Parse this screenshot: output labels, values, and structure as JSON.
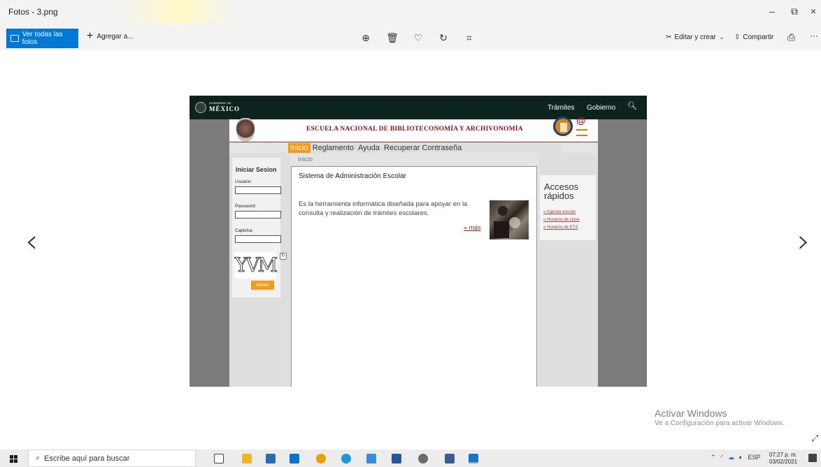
{
  "window": {
    "title": "Fotos - 3.png",
    "min": "–",
    "max": "⧉",
    "close": "×"
  },
  "toolbar": {
    "all_photos": "Ver todas las fotos",
    "add": "Agregar a...",
    "edit_create": "Editar y crear",
    "share": "Compartir",
    "icons": [
      "zoom-in-icon",
      "delete-icon",
      "heart-icon",
      "rotate-icon",
      "crop-icon",
      "print-icon",
      "more-icon"
    ]
  },
  "photo": {
    "gov": {
      "small": "GOBIERNO DE",
      "mexico": "MÉXICO",
      "tramites": "Trámites",
      "gobierno": "Gobierno"
    },
    "school": "ESCUELA NACIONAL DE BIBLIOTECONOMÍA Y ARCHIVONOMÍA",
    "menu": [
      {
        "label": "Inicio"
      },
      {
        "label": "Reglamento"
      },
      {
        "label": "Ayuda"
      },
      {
        "label": "Recuperar Contraseña"
      }
    ],
    "breadcrumb": "Inicio",
    "login": {
      "title": "Iniciar Sesion",
      "user_label": "Usuario:",
      "password_label": "Password:",
      "captcha_label": "Captcha:",
      "captcha_text": "YVM",
      "submit": "Iniciar"
    },
    "main": {
      "title": "Sistema de Administración Escolar",
      "desc": "Es la herramienta informática diseñada para apoyar en la consulta y realización de trámites escolares.",
      "more": "» más"
    },
    "accesos": {
      "title": "Accesos rápidos",
      "links": [
        "» Agenda escolar",
        "» Horarios de clase",
        "» Horarios de ETS"
      ]
    }
  },
  "watermark": {
    "line1": "Activar Windows",
    "line2": "Ve a Configuración para activar Windows."
  },
  "taskbar": {
    "search": "Escribe aquí para buscar",
    "lang": "ESP",
    "time": "07:27 p. m.",
    "date": "03/02/2021"
  },
  "colors": {
    "accent": "#0078d7",
    "orange": "#f39a16",
    "gov_green": "#0c231e",
    "school_red": "#7a1616"
  }
}
